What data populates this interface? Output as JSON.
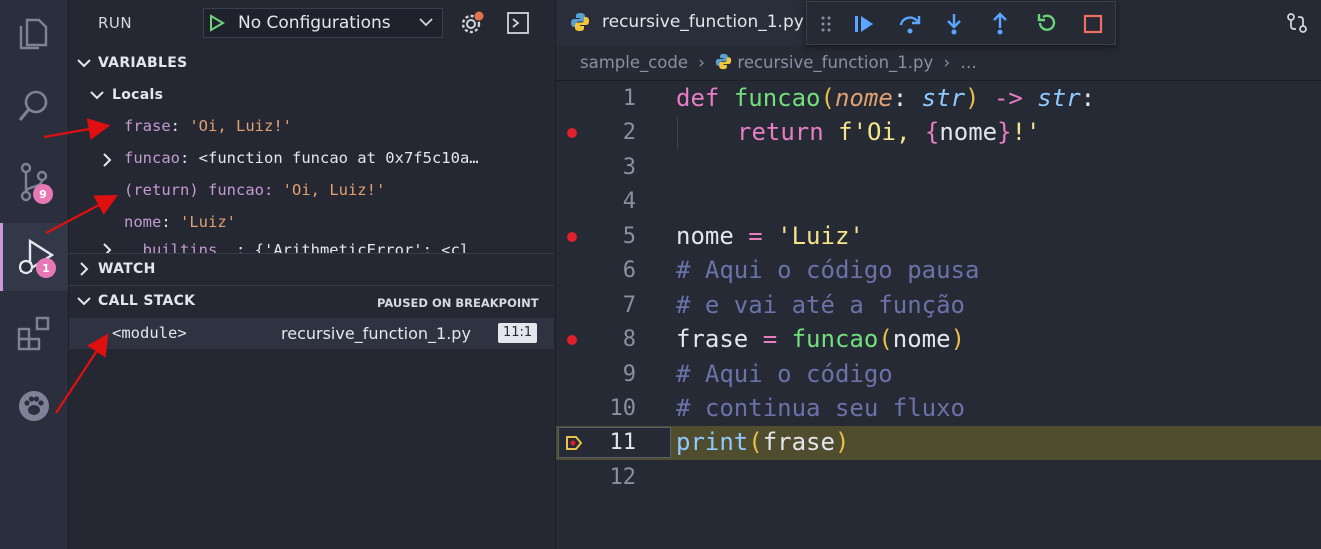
{
  "activity": {
    "source_control_badge": "9",
    "debug_badge": "1"
  },
  "run": {
    "label": "RUN",
    "configuration": "No Configurations"
  },
  "variables": {
    "title": "VARIABLES",
    "locals_label": "Locals",
    "rows": [
      {
        "name": "frase",
        "value": "'Oi, Luiz!'"
      },
      {
        "name": "funcao",
        "value": "<function funcao at 0x7f5c10a…"
      },
      {
        "name": "(return) funcao",
        "value": "'Oi, Luiz!'"
      },
      {
        "name": "nome",
        "value": "'Luiz'"
      },
      {
        "name": "__builtins__",
        "value": "{'ArithmeticError': <cl"
      }
    ]
  },
  "watch": {
    "title": "WATCH"
  },
  "callstack": {
    "title": "CALL STACK",
    "status": "PAUSED ON BREAKPOINT",
    "frame_name": "<module>",
    "frame_file": "recursive_function_1.py",
    "frame_pos": "11:1"
  },
  "editor": {
    "tab_label": "recursive_function_1.py",
    "breadcrumb": [
      "sample_code",
      "recursive_function_1.py",
      "…"
    ],
    "line_numbers": [
      "1",
      "2",
      "3",
      "4",
      "5",
      "6",
      "7",
      "8",
      "9",
      "10",
      "11",
      "12"
    ],
    "code": {
      "l1_def": "def",
      "l1_name": "funcao",
      "l1_param": "nome",
      "l1_type": "str",
      "l1_ret": "str",
      "l2_return": "return",
      "l2_str1": "f'Oi, ",
      "l2_var": "nome",
      "l2_str2": "!'",
      "l5_var": "nome",
      "l5_str": "'Luiz'",
      "l6": "# Aqui o código pausa",
      "l7": "# e vai até a função",
      "l8_var": "frase",
      "l8_fn": "funcao",
      "l8_arg": "nome",
      "l9": "# Aqui o código",
      "l10": "# continua seu fluxo",
      "l11_fn": "print",
      "l11_arg": "frase"
    }
  },
  "colors": {
    "accent_pink": "#e878b5",
    "current_line": "#4f4d2e",
    "breakpoint": "#e0202b",
    "arrow": "#e01010"
  }
}
